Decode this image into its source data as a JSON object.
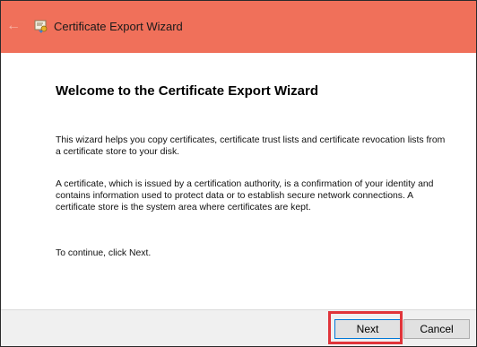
{
  "window": {
    "title": "Certificate Export Wizard",
    "title_icon": "certificate-icon",
    "back_icon": "back-arrow-icon",
    "titlebar_color": "#f0705a"
  },
  "content": {
    "heading": "Welcome to the Certificate Export Wizard",
    "paragraph1": "This wizard helps you copy certificates, certificate trust lists and certificate revocation lists from a certificate store to your disk.",
    "paragraph2": "A certificate, which is issued by a certification authority, is a confirmation of your identity and contains information used to protect data or to establish secure network connections. A certificate store is the system area where certificates are kept.",
    "paragraph3": "To continue, click Next."
  },
  "footer": {
    "next_label": "Next",
    "cancel_label": "Cancel",
    "highlight_color": "#e0343a"
  }
}
